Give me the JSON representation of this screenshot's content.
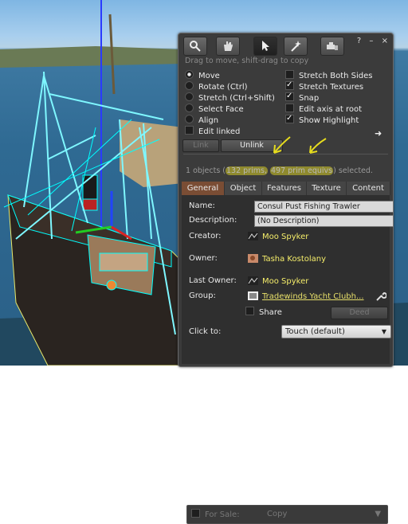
{
  "scene": {
    "description_icon": "boat-object-icon"
  },
  "floater": {
    "hint": "Drag to move, shift-drag to copy",
    "title_buttons": [
      "?",
      "–",
      "×"
    ],
    "tools": [
      {
        "name": "focus-tool-icon"
      },
      {
        "name": "move-hand-icon"
      },
      {
        "name": "edit-pointer-icon"
      },
      {
        "name": "create-wand-icon"
      },
      {
        "name": "land-bulldozer-icon"
      }
    ],
    "left_options": [
      {
        "label": "Move",
        "checked": true
      },
      {
        "label": "Rotate (Ctrl)",
        "checked": false
      },
      {
        "label": "Stretch (Ctrl+Shift)",
        "checked": false
      },
      {
        "label": "Select Face",
        "checked": false
      },
      {
        "label": "Align",
        "checked": false
      }
    ],
    "edit_linked": "Edit linked",
    "right_options": [
      {
        "label": "Stretch Both Sides",
        "checked": false
      },
      {
        "label": "Stretch Textures",
        "checked": true
      },
      {
        "label": "Snap",
        "checked": true
      },
      {
        "label": "Edit axis at root",
        "checked": false
      },
      {
        "label": "Show Highlight",
        "checked": true
      }
    ],
    "link_button": "Link",
    "unlink_button": "Unlink",
    "count": {
      "prefix": "1 objects (",
      "prims": "132 prims,",
      "equivs": "497 prim equivs",
      "suffix": ") selected."
    },
    "tabs": [
      "General",
      "Object",
      "Features",
      "Texture",
      "Content"
    ],
    "general": {
      "name_label": "Name:",
      "name_value": "Consul Pust Fishing Trawler",
      "desc_label": "Description:",
      "desc_value": "(No Description)",
      "creator_label": "Creator:",
      "creator_value": "Moo Spyker",
      "owner_label": "Owner:",
      "owner_value": "Tasha Kostolany",
      "last_owner_label": "Last Owner:",
      "last_owner_value": "Moo Spyker",
      "group_label": "Group:",
      "group_value": "Tradewinds Yacht Clubh...",
      "share_label": "Share",
      "deed_button": "Deed",
      "click_to_label": "Click to:",
      "click_to_value": "Touch  (default)",
      "for_sale_label": "For Sale:",
      "for_sale_value": "Copy"
    }
  }
}
